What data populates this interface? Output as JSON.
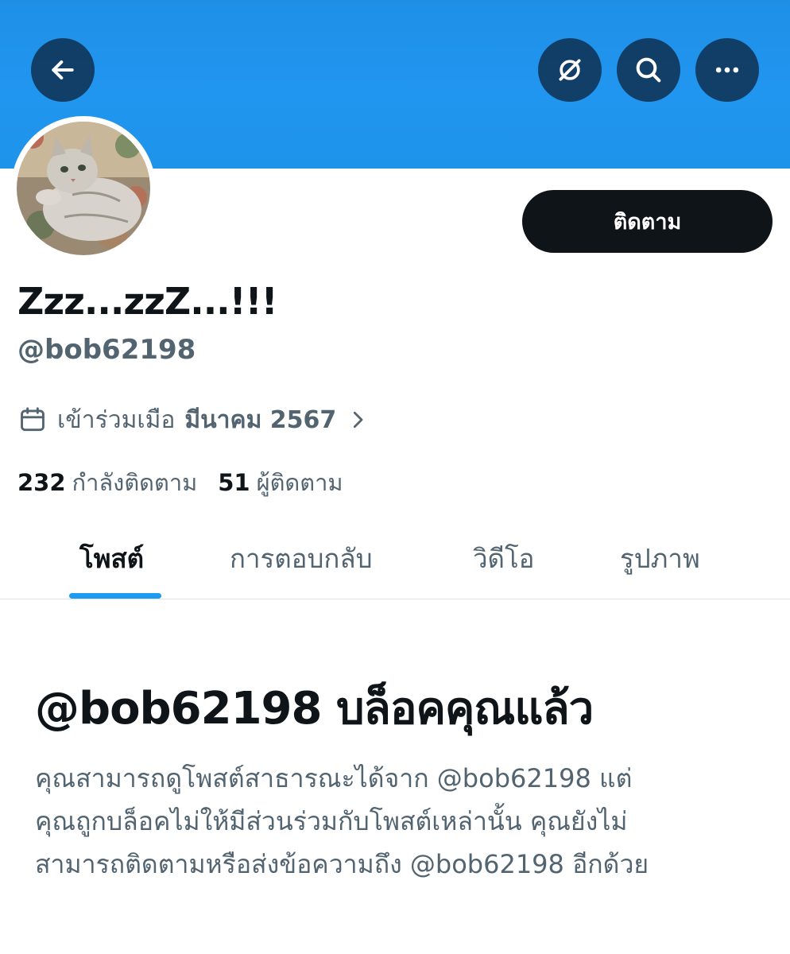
{
  "header": {
    "back_icon": "arrow-left-icon",
    "grok_icon": "grok-icon",
    "search_icon": "search-icon",
    "more_icon": "more-horizontal-icon",
    "banner_color": "#1f8fe6"
  },
  "profile": {
    "avatar_alt": "cat-avatar",
    "follow_label": "ติดตาม",
    "display_name": "Zzz...zzZ...!!!",
    "handle": "@bob62198",
    "joined_prefix": "เข้าร่วมเมือ",
    "joined_date": "มีนาคม 2567"
  },
  "stats": {
    "following_count": "232",
    "following_label": "กำลังติดตาม",
    "followers_count": "51",
    "followers_label": "ผู้ติดตาม"
  },
  "tabs": [
    {
      "label": "โพสต์",
      "active": true
    },
    {
      "label": "การตอบกลับ",
      "active": false
    },
    {
      "label": "วิดีโอ",
      "active": false
    },
    {
      "label": "รูปภาพ",
      "active": false
    }
  ],
  "blocked": {
    "title": "@bob62198 บล็อคคุณแล้ว",
    "line1": "คุณสามารถดูโพสต์สาธารณะได้จาก @bob62198 แต่",
    "line2": "คุณถูกบล็อคไม่ให้มีส่วนร่วมกับโพสต์เหล่านั้น คุณยังไม่",
    "line3": "สามารถติดตามหรือส่งข้อความถึง @bob62198 อีกด้วย"
  },
  "colors": {
    "primary_text": "#0f1419",
    "secondary_text": "#536471",
    "accent": "#1d9bf0"
  }
}
